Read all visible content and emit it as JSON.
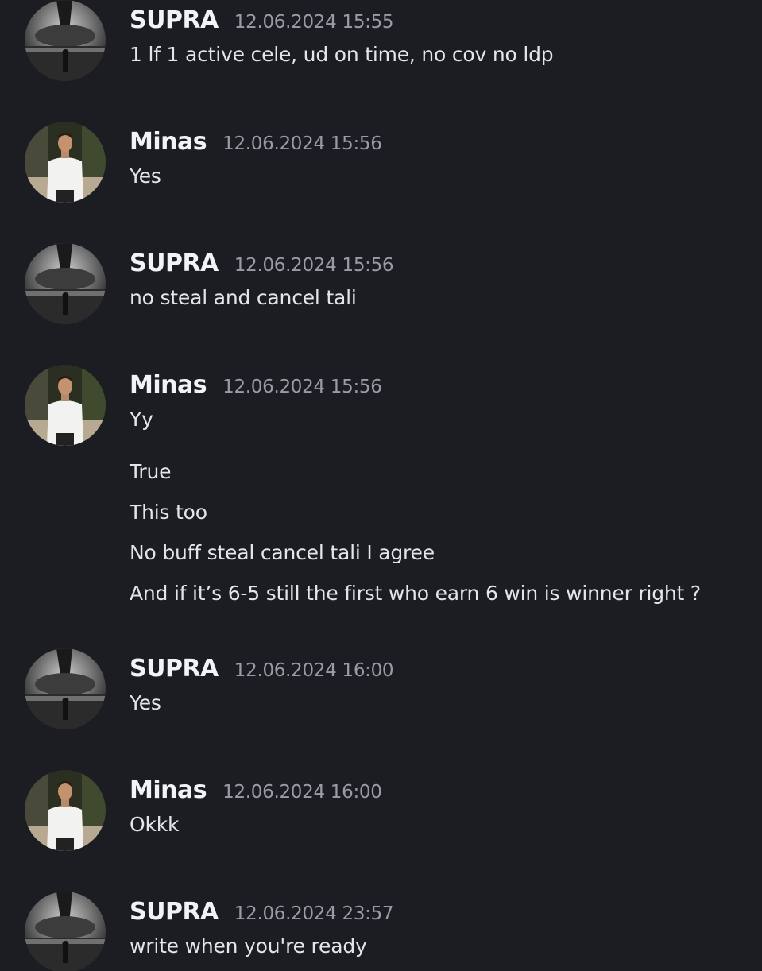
{
  "messages": [
    {
      "author": "SUPRA",
      "timestamp": "12.06.2024 15:55",
      "lines": [
        "1 lf 1 active cele, ud on time, no cov no ldp"
      ]
    },
    {
      "author": "Minas",
      "timestamp": "12.06.2024 15:56",
      "lines": [
        "Yes"
      ]
    },
    {
      "author": "SUPRA",
      "timestamp": "12.06.2024 15:56",
      "lines": [
        "no steal and cancel tali"
      ]
    },
    {
      "author": "Minas",
      "timestamp": "12.06.2024 15:56",
      "lines": [
        "Yy",
        "True",
        "This too",
        "No buff steal cancel tali I agree",
        "And if it’s 6-5 still the first who earn 6 win is winner right ?"
      ]
    },
    {
      "author": "SUPRA",
      "timestamp": "12.06.2024 16:00",
      "lines": [
        "Yes"
      ]
    },
    {
      "author": "Minas",
      "timestamp": "12.06.2024 16:00",
      "lines": [
        "Okkk"
      ]
    },
    {
      "author": "SUPRA",
      "timestamp": "12.06.2024 23:57",
      "lines": [
        "write when you're ready"
      ]
    }
  ]
}
